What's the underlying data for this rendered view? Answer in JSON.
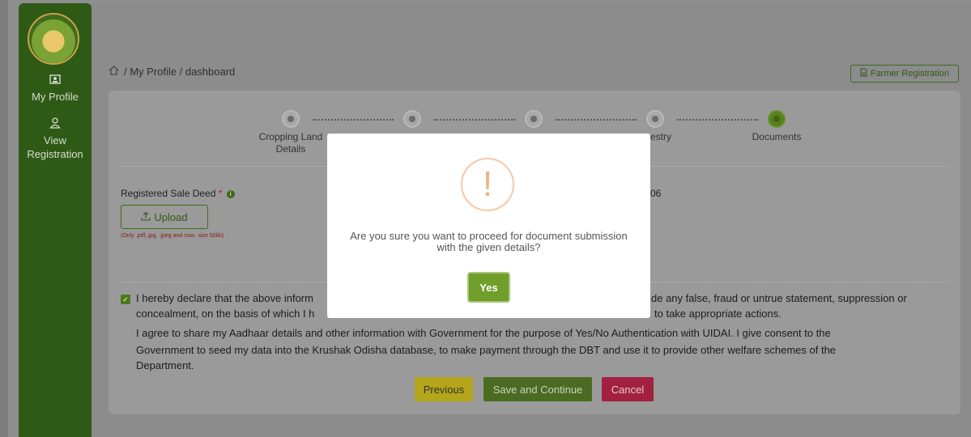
{
  "sidebar": {
    "items": [
      {
        "label": "My Profile",
        "icon": "profile-card-icon"
      },
      {
        "label": "View Registration",
        "icon": "user-icon"
      }
    ]
  },
  "breadcrumb": {
    "text": "/ My Profile / dashboard"
  },
  "header": {
    "farmer_registration_label": "Farmer Registration"
  },
  "stepper": {
    "steps": [
      {
        "label": "Cropping Land Details"
      },
      {
        "label": ""
      },
      {
        "label": ""
      },
      {
        "label": "estry"
      },
      {
        "label": "Documents",
        "active": true
      }
    ]
  },
  "documents": {
    "field_label": "Registered Sale Deed",
    "required_mark": "*",
    "upload_label": "Upload",
    "upload_hint": "(Only .pdf,.jpg, .jpeg and max. size 50kb)",
    "partial_value": "06"
  },
  "declaration": {
    "line1_left": "I hereby declare that the above inform",
    "line1_right": "de any false, fraud or untrue statement, suppression or",
    "line2_left": "concealment, on the basis of which I h",
    "line2_right": "to take appropriate actions.",
    "line3": "I agree to share my Aadhaar details and other information with Government for the purpose of Yes/No Authentication with UIDAI. I give consent to the",
    "line4": "Government to seed my data into the Krushak Odisha database, to make payment through the DBT and use it to provide other welfare schemes of the",
    "line5": "Department."
  },
  "actions": {
    "previous_label": "Previous",
    "save_label": "Save and Continue",
    "cancel_label": "Cancel"
  },
  "modal": {
    "icon": "!",
    "message": "Are you sure you want to proceed for document submission with the given details?",
    "confirm_label": "Yes"
  },
  "colors": {
    "sidebar": "#2e5a16",
    "accent_green": "#6f9e2a",
    "cancel_red": "#a32040",
    "previous_yellow": "#b4a51a",
    "alert_icon": "#f3b084"
  }
}
